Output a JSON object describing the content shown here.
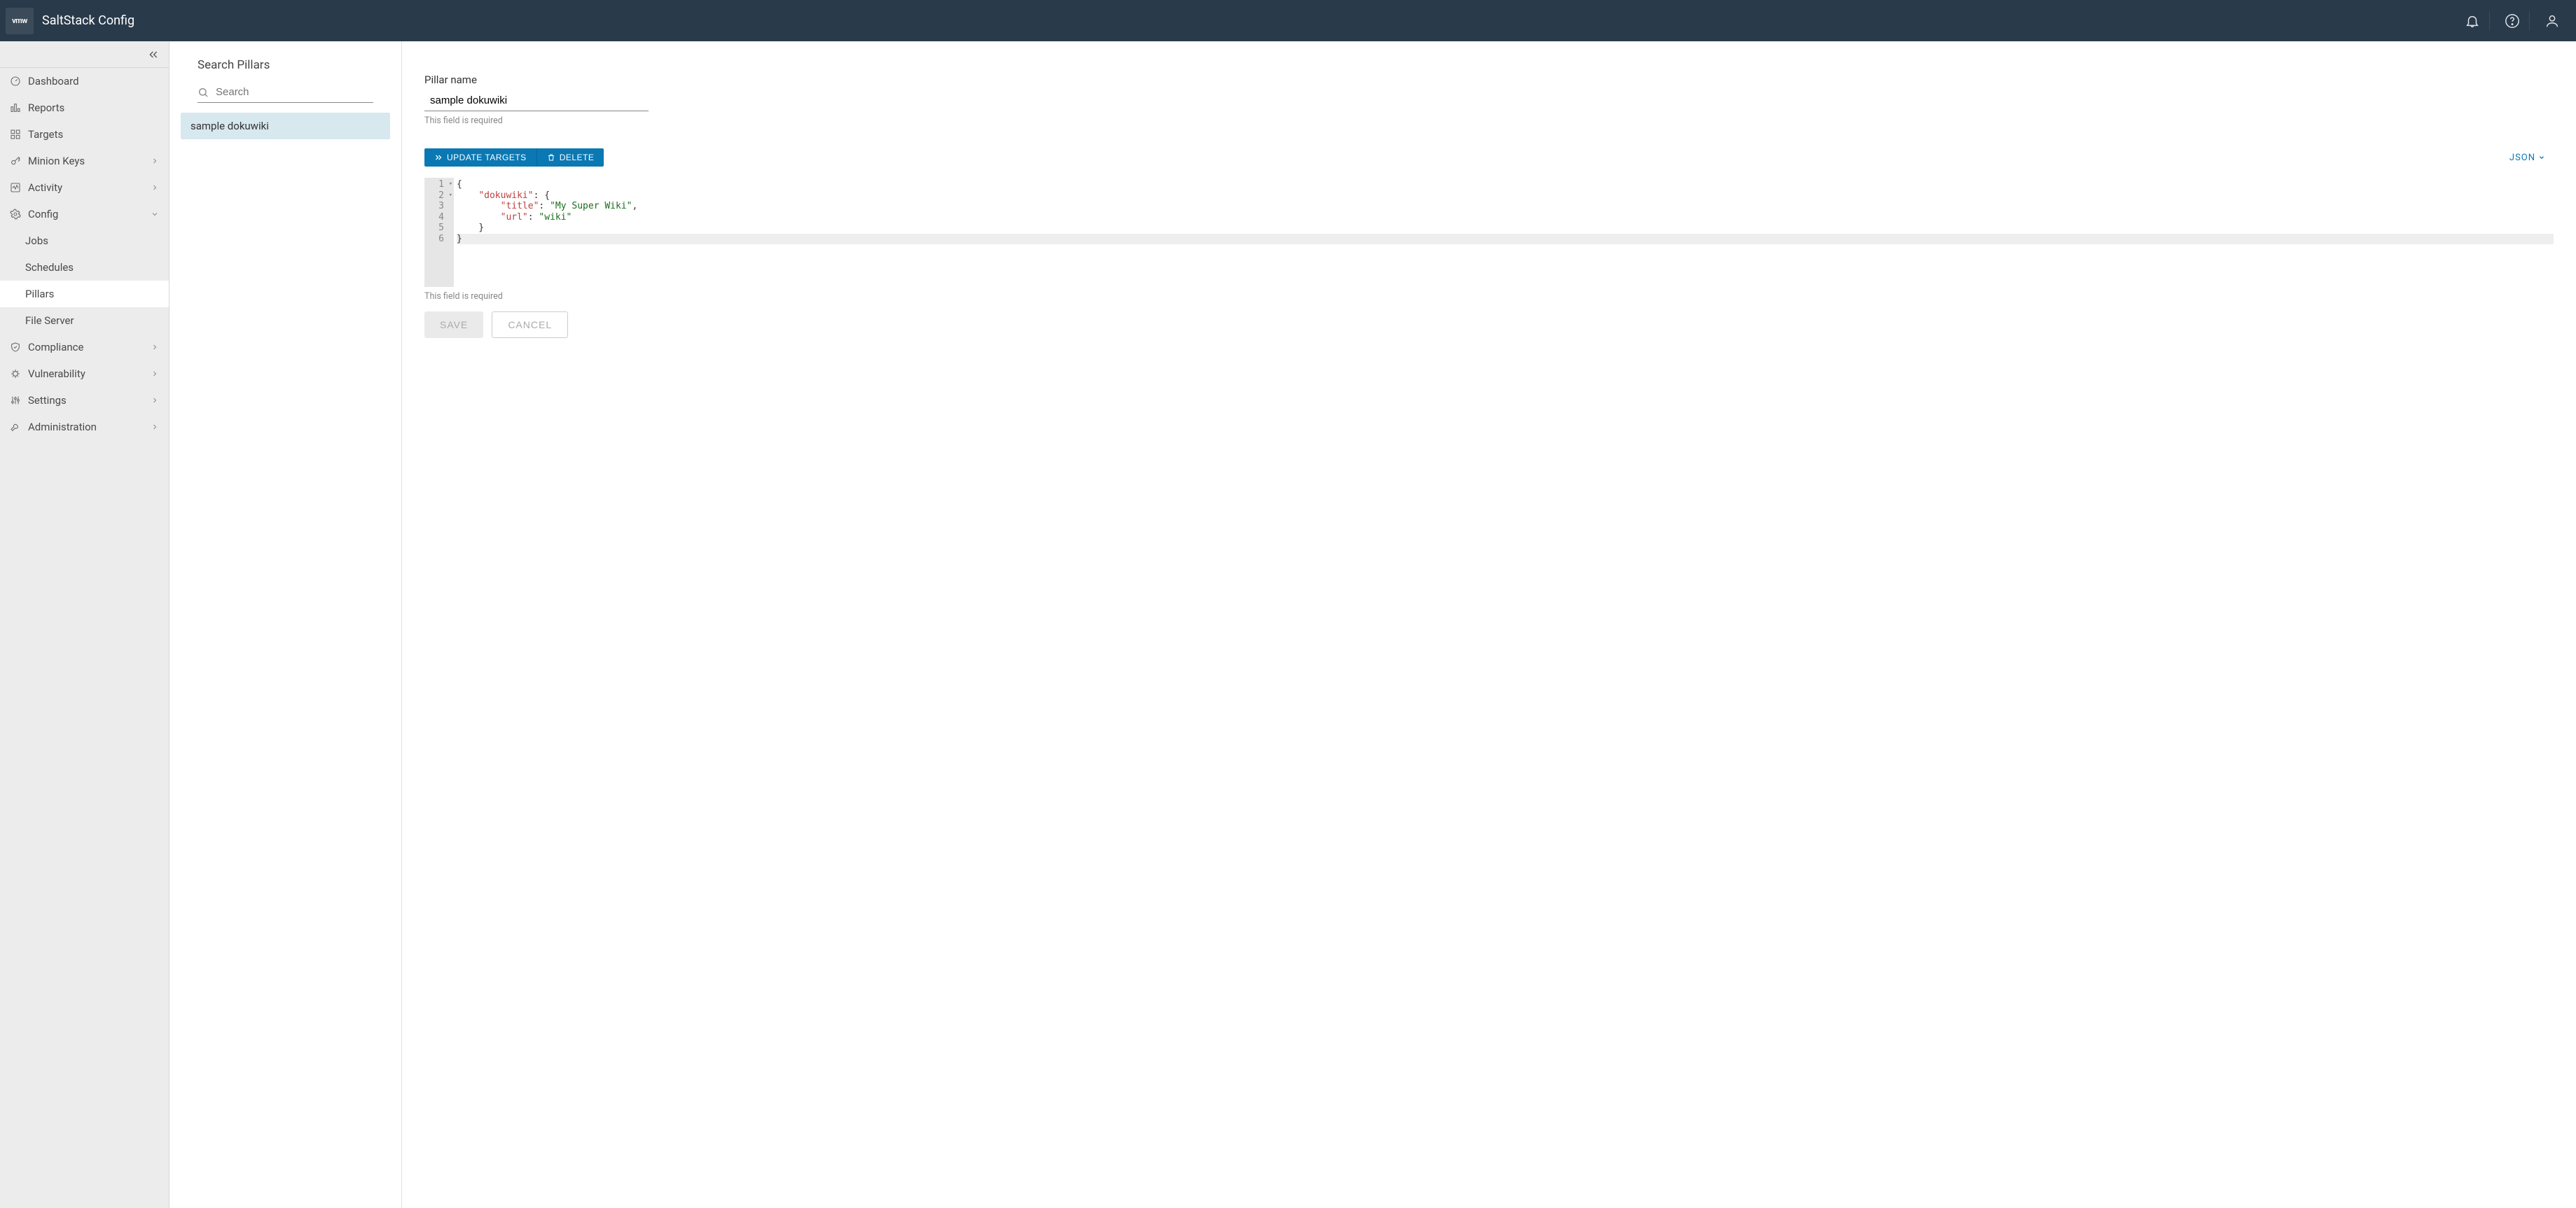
{
  "header": {
    "logo": "vmw",
    "title": "SaltStack Config"
  },
  "sidebar": {
    "items": [
      {
        "icon": "gauge",
        "label": "Dashboard",
        "expandable": false
      },
      {
        "icon": "barchart",
        "label": "Reports",
        "expandable": false
      },
      {
        "icon": "grid",
        "label": "Targets",
        "expandable": false
      },
      {
        "icon": "key",
        "label": "Minion Keys",
        "expandable": true,
        "expanded": false
      },
      {
        "icon": "activity",
        "label": "Activity",
        "expandable": true,
        "expanded": false
      },
      {
        "icon": "gear",
        "label": "Config",
        "expandable": true,
        "expanded": true,
        "children": [
          {
            "label": "Jobs",
            "active": false
          },
          {
            "label": "Schedules",
            "active": false
          },
          {
            "label": "Pillars",
            "active": true
          },
          {
            "label": "File Server",
            "active": false
          }
        ]
      },
      {
        "icon": "shield",
        "label": "Compliance",
        "expandable": true,
        "expanded": false
      },
      {
        "icon": "bug",
        "label": "Vulnerability",
        "expandable": true,
        "expanded": false
      },
      {
        "icon": "sliders",
        "label": "Settings",
        "expandable": true,
        "expanded": false
      },
      {
        "icon": "wrench",
        "label": "Administration",
        "expandable": true,
        "expanded": false
      }
    ]
  },
  "pillarList": {
    "title": "Search Pillars",
    "search_placeholder": "Search",
    "items": [
      {
        "label": "sample dokuwiki",
        "selected": true
      }
    ]
  },
  "detail": {
    "name_label": "Pillar name",
    "name_value": "sample dokuwiki",
    "required_hint": "This field is required",
    "update_targets_label": "UPDATE TARGETS",
    "delete_label": "DELETE",
    "format_label": "JSON",
    "editor_required_hint": "This field is required",
    "save_label": "SAVE",
    "cancel_label": "CANCEL",
    "code": {
      "lines": [
        "{",
        "    \"dokuwiki\": {",
        "        \"title\": \"My Super Wiki\",",
        "        \"url\": \"wiki\"",
        "    }",
        "}"
      ]
    }
  },
  "chart_data": {
    "type": "table",
    "note": "JSON content displayed in the pillar code editor",
    "data": {
      "dokuwiki": {
        "title": "My Super Wiki",
        "url": "wiki"
      }
    }
  }
}
